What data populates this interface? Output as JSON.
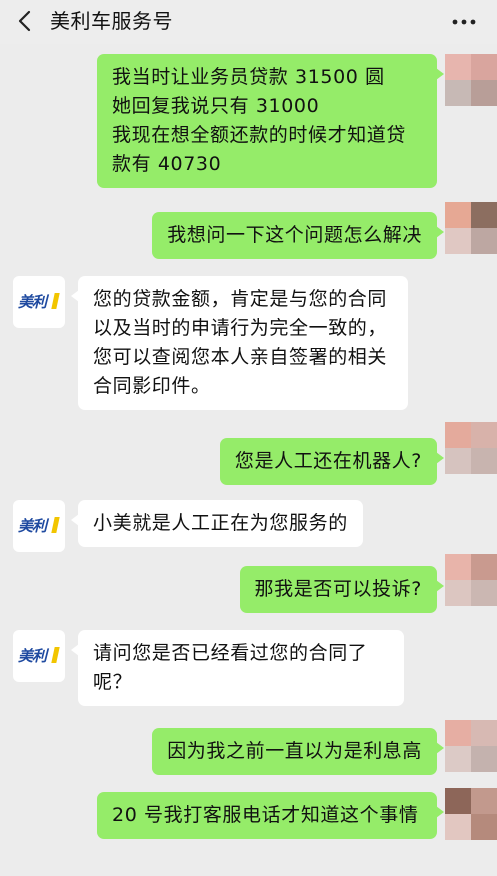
{
  "header": {
    "title": "美利车服务号"
  },
  "messages": [
    {
      "side": "right",
      "text": "我当时让业务员贷款 31500 圆\n她回复我说只有 31000\n我现在想全额还款的时候才知道贷款有 40730"
    },
    {
      "side": "right",
      "text": "我想问一下这个问题怎么解决"
    },
    {
      "side": "left",
      "text": "您的贷款金额，肯定是与您的合同以及当时的申请行为完全一致的，您可以查阅您本人亲自签署的相关合同影印件。"
    },
    {
      "side": "right",
      "text": "您是人工还在机器人?"
    },
    {
      "side": "left",
      "text": "小美就是人工正在为您服务的"
    },
    {
      "side": "right",
      "text": "那我是否可以投诉?"
    },
    {
      "side": "left",
      "text": "请问您是否已经看过您的合同了呢？"
    },
    {
      "side": "right",
      "text": "因为我之前一直以为是利息高"
    },
    {
      "side": "right",
      "text": "20 号我打客服电话才知道这个事情"
    }
  ],
  "assistant_avatar": {
    "logo_text": "美利"
  },
  "colors": {
    "background": "#ececec",
    "user_bubble": "#95ec69",
    "assistant_bubble": "#ffffff",
    "logo_blue": "#1f4aa0",
    "logo_yellow": "#f2c500"
  },
  "icons": {
    "back": "chevron-left-icon",
    "more": "more-dots-icon"
  }
}
